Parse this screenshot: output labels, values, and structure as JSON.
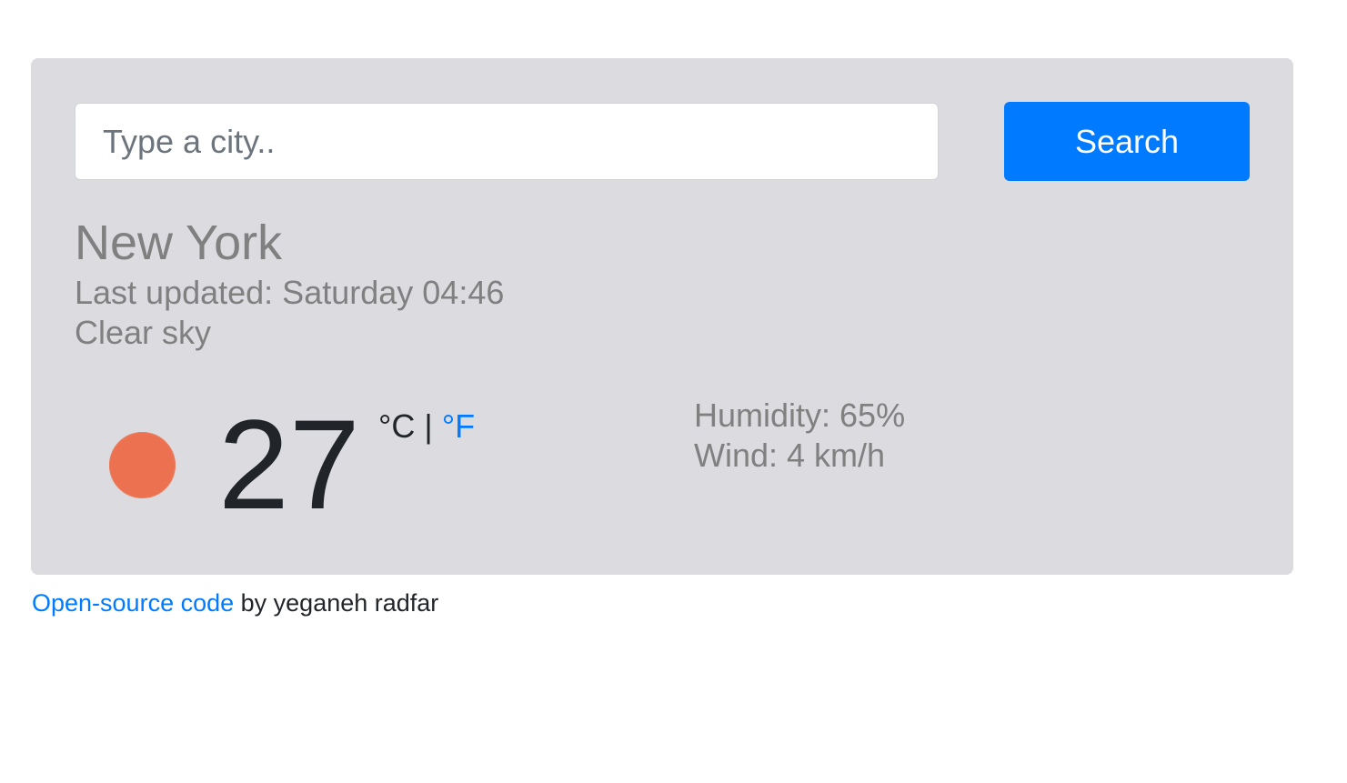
{
  "search": {
    "placeholder": "Type a city..",
    "value": "",
    "button_label": "Search"
  },
  "weather": {
    "city": "New York",
    "last_updated": "Last updated: Saturday 04:46",
    "description": "Clear sky",
    "icon": "sun-icon",
    "temperature": "27",
    "unit_celsius": "°C",
    "unit_separator": " | ",
    "unit_fahrenheit": "°F",
    "humidity": "Humidity: 65%",
    "wind": "Wind: 4 km/h"
  },
  "footer": {
    "link_label": "Open-source code",
    "text": " by yeganeh radfar"
  },
  "colors": {
    "card_background": "#dbdbe0",
    "accent": "#007bff",
    "icon_sun": "#ec7150",
    "muted_text": "#808080"
  }
}
